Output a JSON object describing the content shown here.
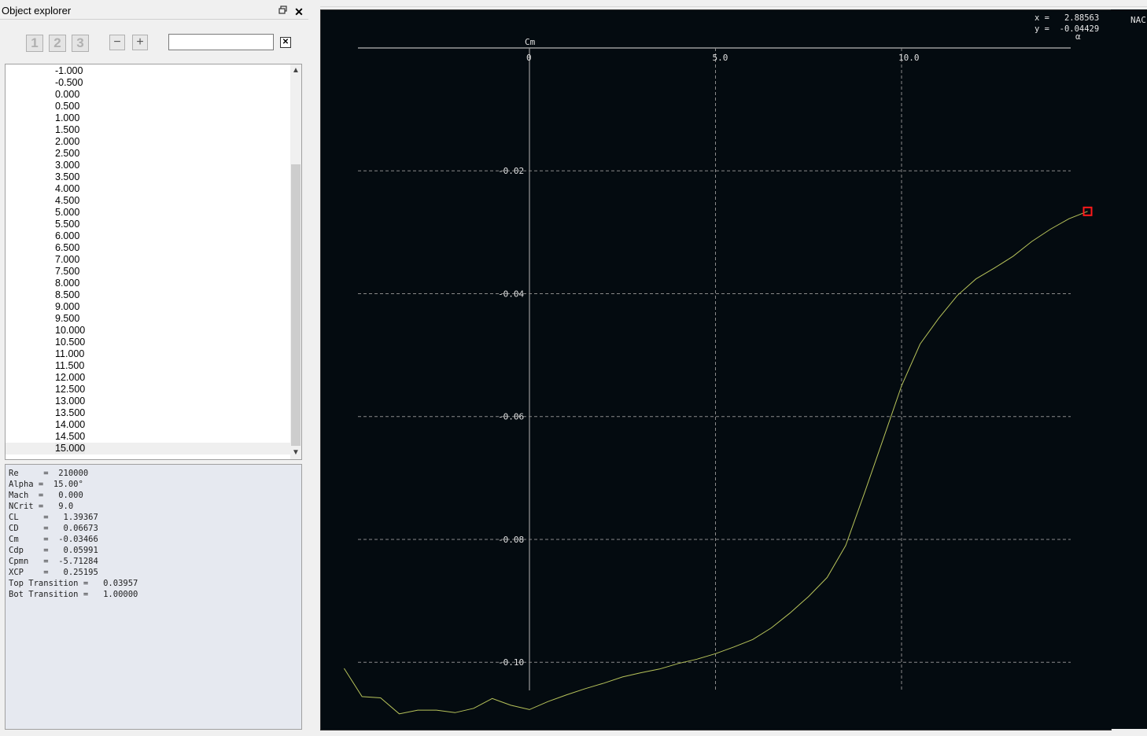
{
  "dock": {
    "title": "Object explorer",
    "float_icon": "float-icon",
    "close_label": "✕",
    "buttons": {
      "one": "1",
      "two": "2",
      "three": "3",
      "minus": "−",
      "plus": "+"
    },
    "filter": {
      "value": "",
      "clear_label": "✕"
    }
  },
  "tree": {
    "items": [
      "-1.000",
      "-0.500",
      "0.000",
      "0.500",
      "1.000",
      "1.500",
      "2.000",
      "2.500",
      "3.000",
      "3.500",
      "4.000",
      "4.500",
      "5.000",
      "5.500",
      "6.000",
      "6.500",
      "7.000",
      "7.500",
      "8.000",
      "8.500",
      "9.000",
      "9.500",
      "10.000",
      "10.500",
      "11.000",
      "11.500",
      "12.000",
      "12.500",
      "13.000",
      "13.500",
      "14.000",
      "14.500",
      "15.000"
    ],
    "selected": "15.000",
    "scroll_up": "▲",
    "scroll_down": "▼"
  },
  "properties": {
    "text": "Re     =  210000\nAlpha =  15.00°\nMach  =   0.000\nNCrit =   9.0\nCL     =   1.39367\nCD     =   0.06673\nCm     =  -0.03466\nCdp    =   0.05991\nCpmn   =  -5.71284\nXCP    =   0.25195\nTop Transition =   0.03957\nBot Transition =   1.00000"
  },
  "readout": {
    "x_label": "x =",
    "x_value": "2.88563",
    "y_label": "y =",
    "y_value": "-0.04429"
  },
  "right_panel": {
    "text": "NAC"
  },
  "chart_data": {
    "type": "line",
    "title": "",
    "xlabel": "α",
    "ylabel": "Cm",
    "xlim": [
      -4.6,
      14.6
    ],
    "ylim": [
      -0.1065,
      -0.0035
    ],
    "x_ticks": [
      0,
      5.0,
      10.0
    ],
    "x_tick_labels": [
      "0",
      "5.0",
      "10.0"
    ],
    "y_ticks": [
      -0.02,
      -0.04,
      -0.06,
      -0.08,
      -0.1
    ],
    "y_tick_labels": [
      "-0.02",
      "-0.04",
      "-0.06",
      "-0.08",
      "-0.10"
    ],
    "grid": true,
    "series": [
      {
        "color": "#b7c35a",
        "x": [
          -4.98,
          -4.5,
          -4.0,
          -3.5,
          -3.0,
          -2.5,
          -2.0,
          -1.5,
          -1.0,
          -0.5,
          0.0,
          0.5,
          1.0,
          1.5,
          2.0,
          2.5,
          3.0,
          3.5,
          4.0,
          4.5,
          5.0,
          5.5,
          6.0,
          6.5,
          7.0,
          7.5,
          8.0,
          8.5,
          9.0,
          9.5,
          10.0,
          10.5,
          11.0,
          11.5,
          12.0,
          12.5,
          13.0,
          13.5,
          14.0,
          14.5,
          15.0
        ],
        "y": [
          -0.101,
          -0.1056,
          -0.1058,
          -0.1084,
          -0.1078,
          -0.1078,
          -0.1082,
          -0.1075,
          -0.1059,
          -0.107,
          -0.1077,
          -0.1064,
          -0.1053,
          -0.1043,
          -0.1034,
          -0.1024,
          -0.1017,
          -0.1011,
          -0.1002,
          -0.0995,
          -0.0986,
          -0.0975,
          -0.0963,
          -0.0944,
          -0.092,
          -0.0893,
          -0.0862,
          -0.081,
          -0.0725,
          -0.0638,
          -0.055,
          -0.0482,
          -0.044,
          -0.0403,
          -0.0376,
          -0.0358,
          -0.0339,
          -0.0315,
          -0.0295,
          -0.0278,
          -0.0266
        ]
      }
    ],
    "selected_point": {
      "x": 15.0,
      "y": -0.0266,
      "color": "#ff1a1a"
    }
  }
}
